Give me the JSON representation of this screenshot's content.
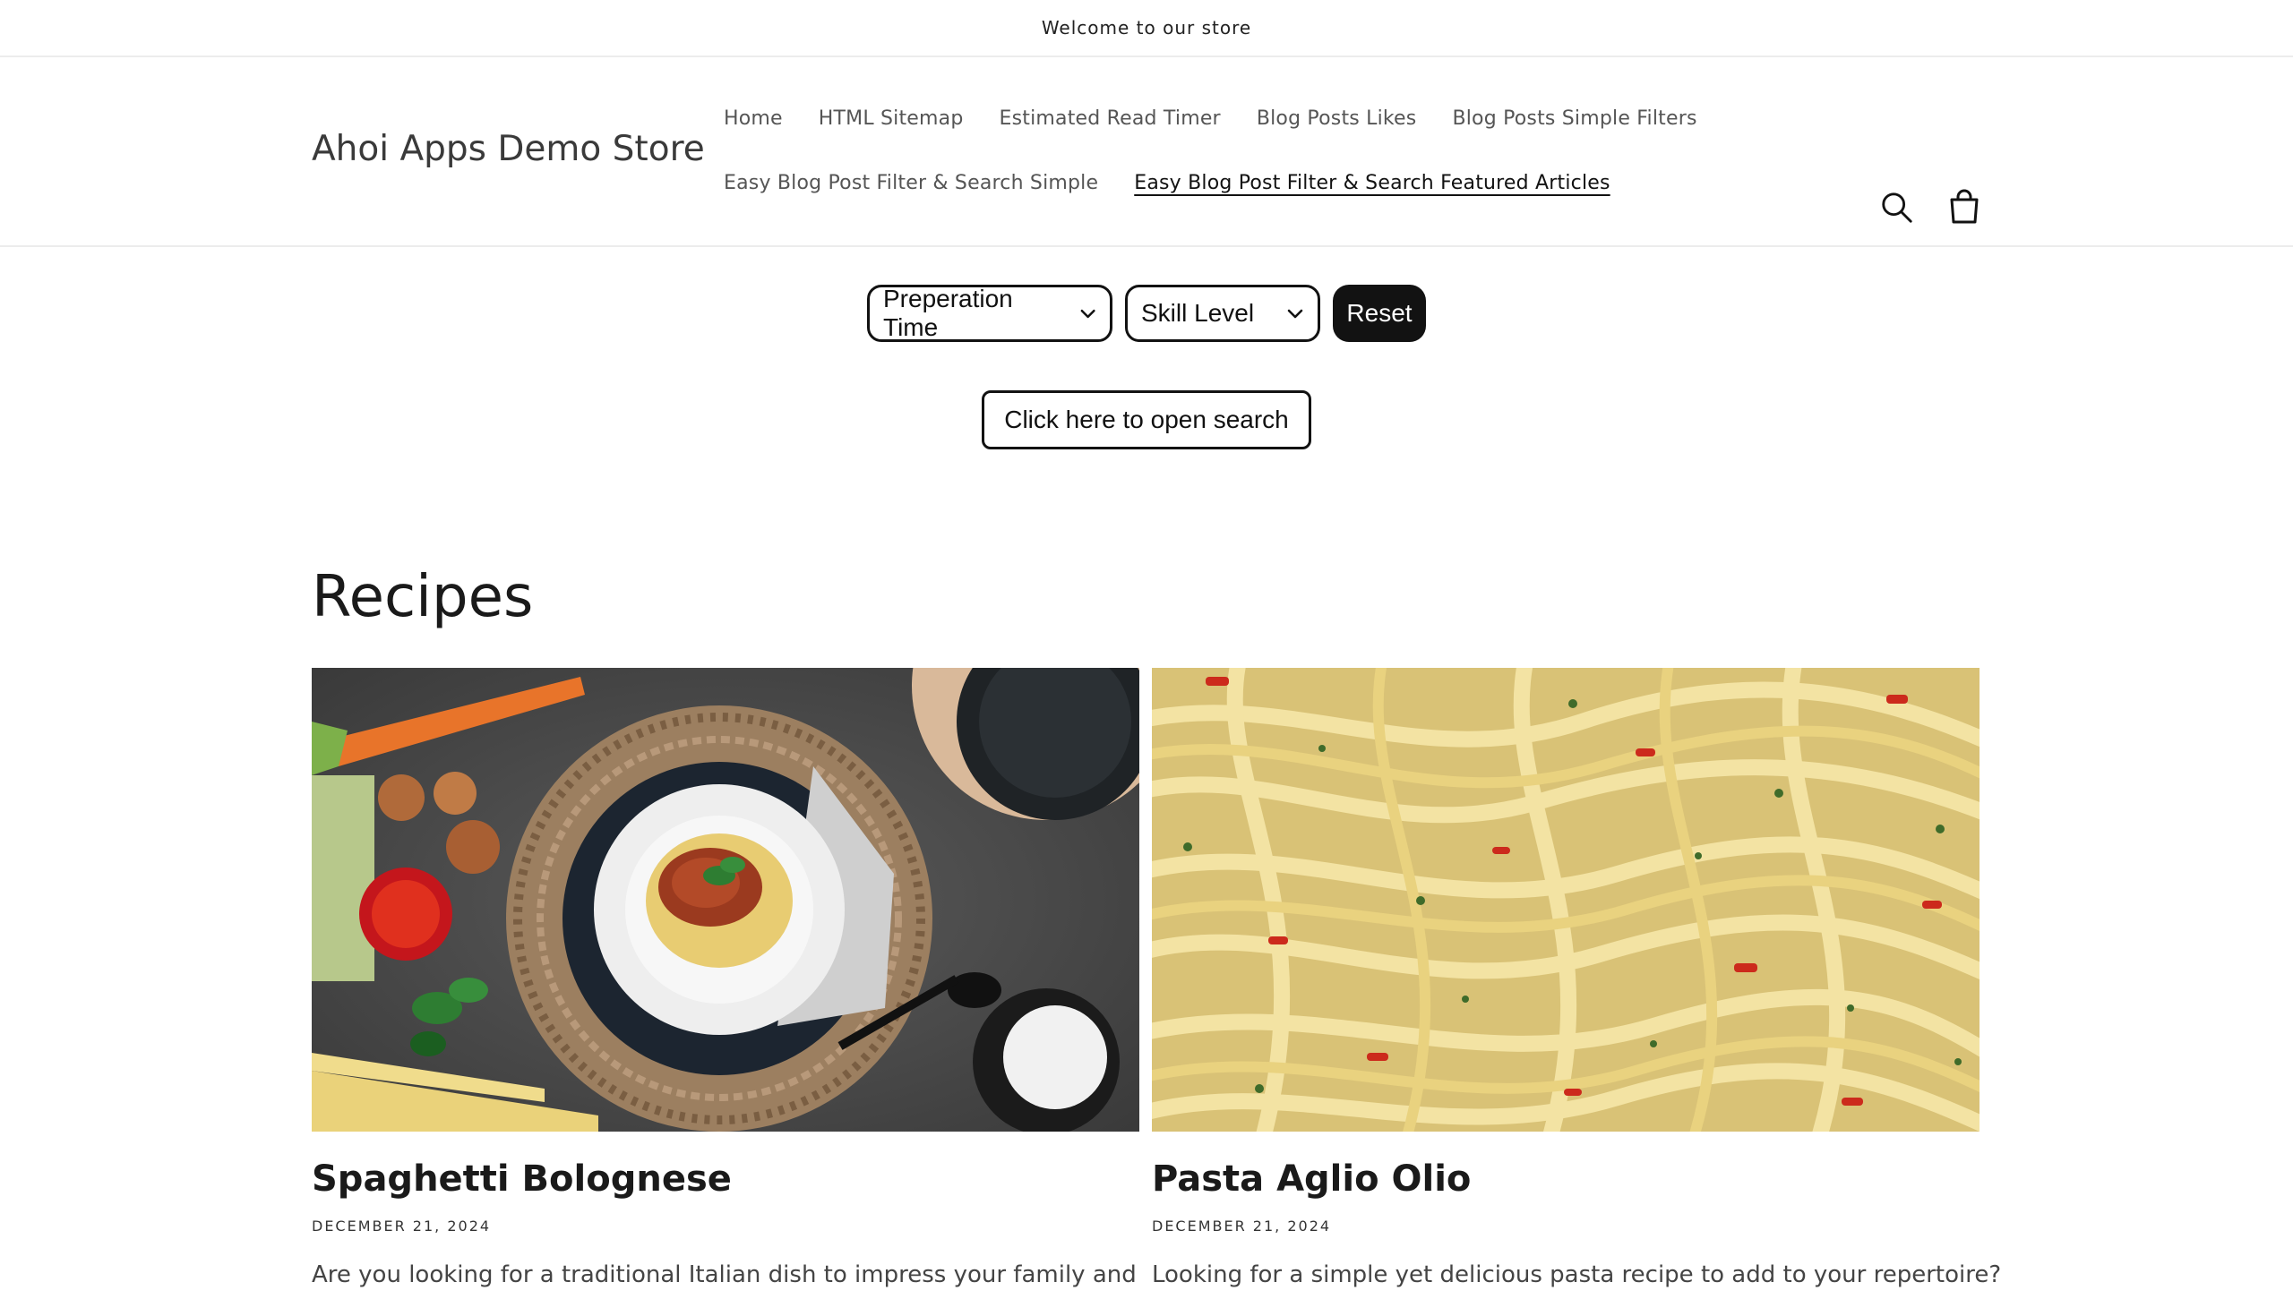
{
  "announcement": "Welcome to our store",
  "header": {
    "logo": "Ahoi Apps Demo Store",
    "nav_row1": [
      "Home",
      "HTML Sitemap",
      "Estimated Read Timer",
      "Blog Posts Likes",
      "Blog Posts Simple Filters"
    ],
    "nav_row2": [
      "Easy Blog Post Filter & Search Simple",
      "Easy Blog Post Filter & Search Featured Articles"
    ],
    "active_nav": "Easy Blog Post Filter & Search Featured Articles",
    "icons": [
      "search-icon",
      "cart-icon"
    ]
  },
  "filters": {
    "prep_time": "Preperation Time",
    "skill_level": "Skill Level",
    "reset": "Reset",
    "open_search": "Click here to open search"
  },
  "section": {
    "title": "Recipes"
  },
  "articles": [
    {
      "title": "Spaghetti Bolognese",
      "date": "DECEMBER 21, 2024",
      "excerpt": "Are you looking for a traditional Italian dish to impress your family and"
    },
    {
      "title": "Pasta Aglio Olio",
      "date": "DECEMBER 21, 2024",
      "excerpt": "Looking for a simple yet delicious pasta recipe to add to your repertoire?"
    }
  ],
  "colors": {
    "text": "#121212",
    "button_dark": "#121212",
    "border": "#ececec"
  }
}
